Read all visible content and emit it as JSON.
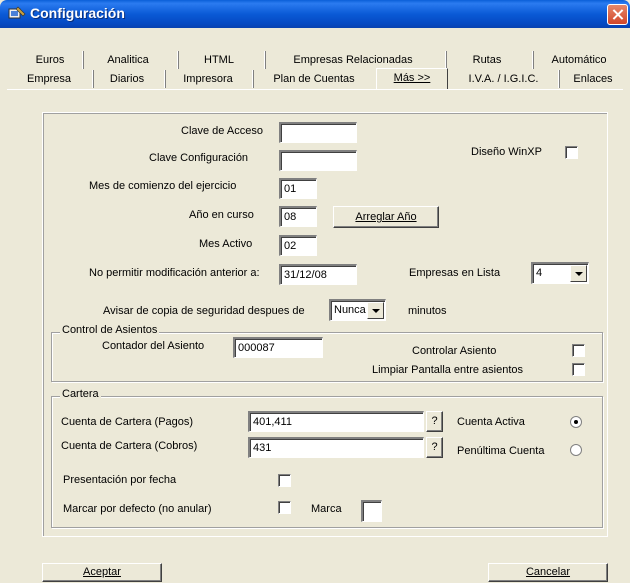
{
  "window": {
    "title": "Configuración"
  },
  "tabs_row1": [
    {
      "label": "Euros"
    },
    {
      "label": "Analitica"
    },
    {
      "label": "HTML"
    },
    {
      "label": "Empresas Relacionadas"
    },
    {
      "label": "Rutas"
    },
    {
      "label": "Automático"
    }
  ],
  "tabs_row2": [
    {
      "label": "Empresa"
    },
    {
      "label": "Diarios"
    },
    {
      "label": "Impresora"
    },
    {
      "label": "Plan de Cuentas"
    },
    {
      "label": "Más >>"
    },
    {
      "label": "I.V.A. / I.G.I.C."
    },
    {
      "label": "Enlaces"
    }
  ],
  "active_tab": "Más >>",
  "form": {
    "clave_acceso": {
      "label": "Clave de Acceso",
      "value": ""
    },
    "clave_config": {
      "label": "Clave Configuración",
      "value": ""
    },
    "diseno_winxp": {
      "label": "Diseño WinXP",
      "checked": false
    },
    "mes_comienzo": {
      "label": "Mes de comienzo del ejercicio",
      "value": "01"
    },
    "anio_curso": {
      "label": "Año en curso",
      "value": "08"
    },
    "arreglar_anio": {
      "label": "Arreglar Año"
    },
    "mes_activo": {
      "label": "Mes Activo",
      "value": "02"
    },
    "no_permitir": {
      "label": "No permitir modificación anterior a:",
      "value": "31/12/08"
    },
    "empresas_lista": {
      "label": "Empresas en Lista",
      "value": "4"
    },
    "avisar_copia": {
      "label": "Avisar de copia de seguridad despues de",
      "value": "Nunca",
      "suffix": "minutos"
    }
  },
  "control_asientos": {
    "legend": "Control de Asientos",
    "contador": {
      "label": "Contador del Asiento",
      "value": "000087"
    },
    "controlar": {
      "label": "Controlar Asiento",
      "checked": false
    },
    "limpiar": {
      "label": "Limpiar Pantalla entre asientos",
      "checked": false
    }
  },
  "cartera": {
    "legend": "Cartera",
    "pagos": {
      "label": "Cuenta de Cartera (Pagos)",
      "value": "401,411",
      "help": "?"
    },
    "cobros": {
      "label": "Cuenta de Cartera (Cobros)",
      "value": "431",
      "help": "?"
    },
    "cuenta_activa": {
      "label": "Cuenta Activa",
      "selected": true
    },
    "penultima": {
      "label": "Penúltima Cuenta",
      "selected": false
    },
    "presentacion_fecha": {
      "label": "Presentación por fecha",
      "checked": false
    },
    "marcar_defecto": {
      "label": "Marcar por defecto (no anular)",
      "checked": false
    },
    "marca": {
      "label": "Marca",
      "value": ""
    }
  },
  "buttons": {
    "aceptar": "Aceptar",
    "cancelar": "Cancelar"
  },
  "colors": {
    "titlebar": "#0a5ad6",
    "face": "#ece9d8",
    "close": "#d2462a"
  }
}
